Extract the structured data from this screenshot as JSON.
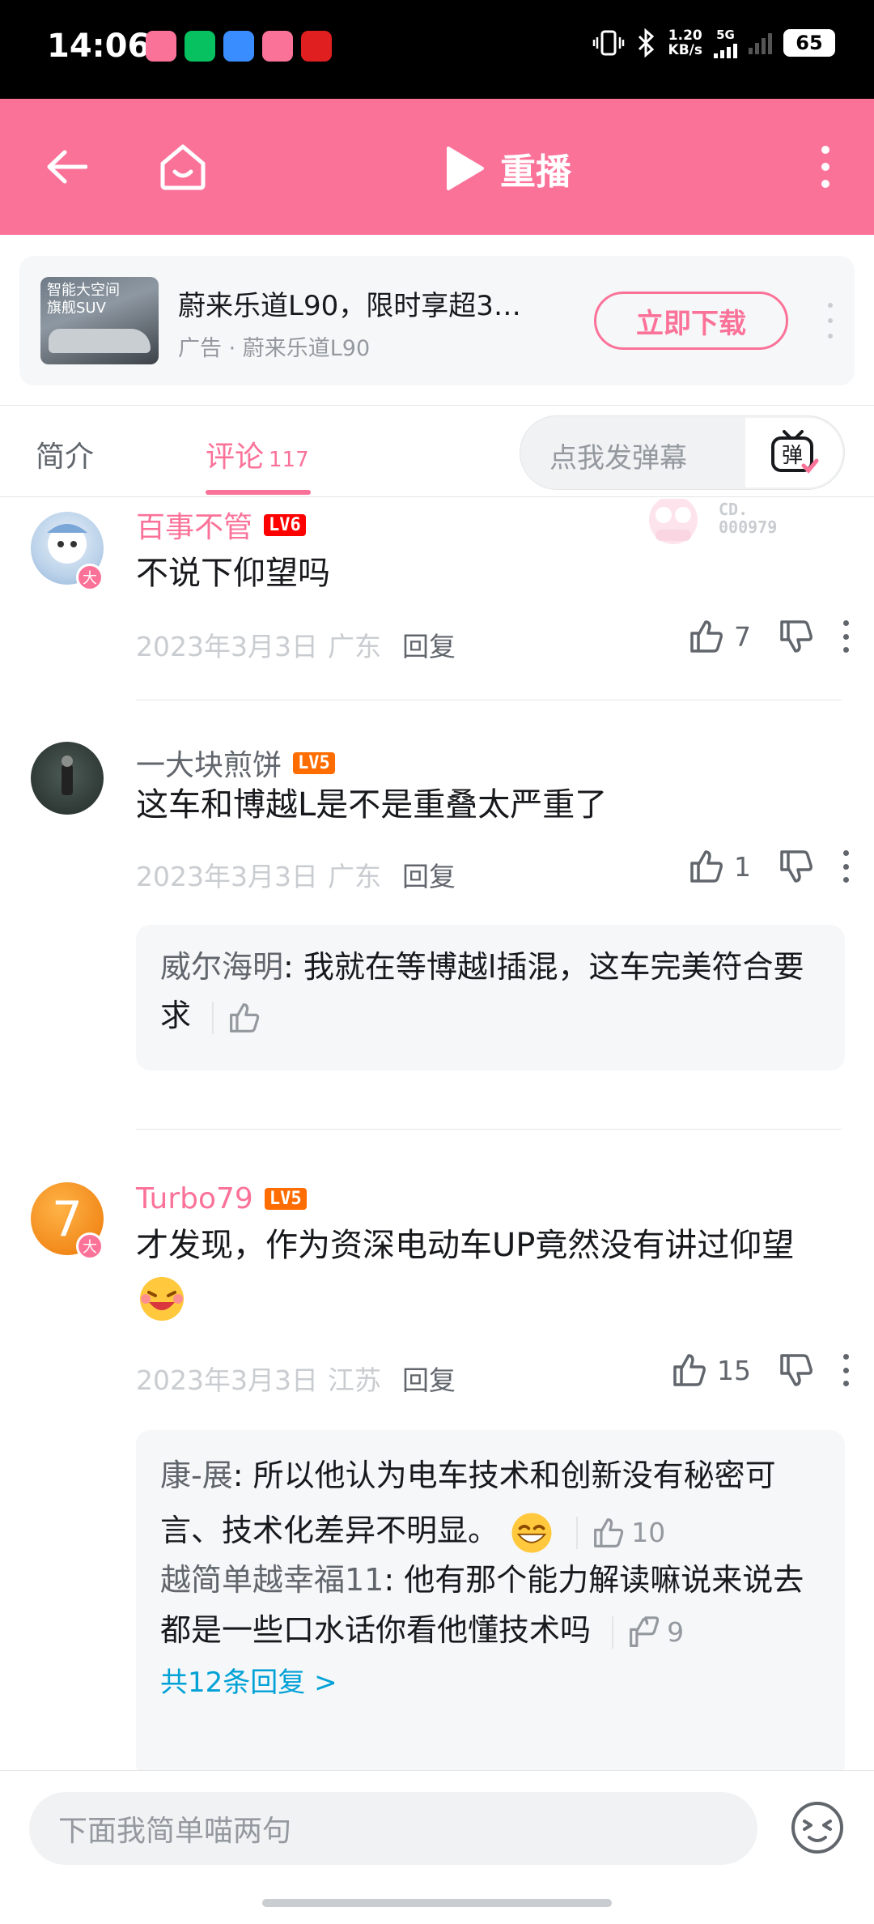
{
  "status_bar": {
    "time": "14:06",
    "net_speed": "1.20\nKB/s",
    "net_type": "5G",
    "battery": "65",
    "app_colors": [
      "#fb7299",
      "#07c160",
      "#3a8dff",
      "#fb7299",
      "#e02020"
    ]
  },
  "header": {
    "replay_label": "重播",
    "bg_color": "#fb7299"
  },
  "ad": {
    "thumb_text": "智能大空间\n旗舰SUV",
    "title": "蔚来乐道L90，限时享超3…",
    "subtitle": "广告 · 蔚来乐道L90",
    "cta": "立即下载"
  },
  "tabs": {
    "intro": "简介",
    "comments": "评论",
    "comments_count": "117",
    "danmaku_placeholder": "点我发弹幕",
    "danmaku_icon_label": "弹"
  },
  "comments": [
    {
      "user": "百事不管",
      "level": "LV6",
      "text": "不说下仰望吗",
      "date": "2023年3月3日",
      "location": "广东",
      "reply": "回复",
      "likes": "7",
      "fan_badge": "CD.\n000979"
    },
    {
      "user": "一大块煎饼",
      "level": "LV5",
      "text": "这车和博越L是不是重叠太严重了",
      "date": "2023年3月3日",
      "location": "广东",
      "reply": "回复",
      "likes": "1",
      "replies": [
        {
          "name": "威尔海明",
          "text": "我就在等博越l插混，这车完美符合要求",
          "likes": ""
        }
      ]
    },
    {
      "user": "Turbo79",
      "level": "LV5",
      "text": "才发现，作为资深电动车UP竟然没有讲过仰望",
      "date": "2023年3月3日",
      "location": "江苏",
      "reply": "回复",
      "likes": "15",
      "avatar_char": "7",
      "replies": [
        {
          "name": "康-展",
          "text": "所以他认为电车技术和创新没有秘密可言、技术化差异不明显。",
          "likes": "10"
        },
        {
          "name": "越简单越幸福11",
          "text": "他有那个能力解读嘛说来说去都是一些口水话你看他懂技术吗",
          "likes": "9"
        }
      ],
      "more_replies": "共12条回复 >"
    }
  ],
  "vip_badge": "大",
  "bottom": {
    "input_placeholder": "下面我简单喵两句"
  }
}
